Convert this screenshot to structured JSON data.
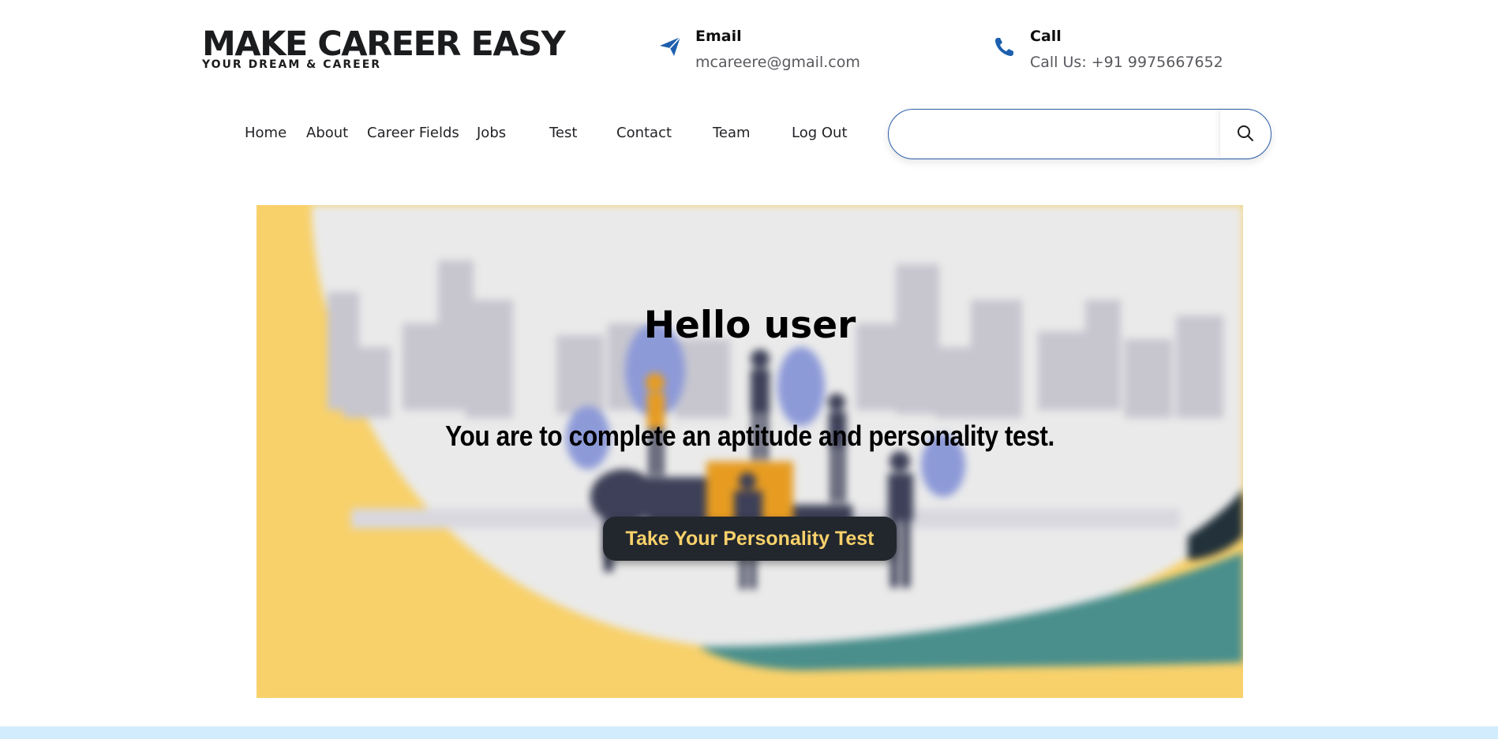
{
  "brand": {
    "title": "MAKE CAREER EASY",
    "tagline": "YOUR DREAM & CAREER"
  },
  "contacts": {
    "email": {
      "label": "Email",
      "value": "mcareere@gmail.com",
      "icon": "paper-plane-icon"
    },
    "call": {
      "label": "Call",
      "value": "Call Us: +91 9975667652",
      "icon": "phone-icon"
    }
  },
  "nav": {
    "items": [
      "Home",
      "About",
      "Career Fields",
      "Jobs",
      "Test",
      "Contact",
      "Team",
      "Log Out"
    ]
  },
  "search": {
    "placeholder": "",
    "icon": "search-icon"
  },
  "hero": {
    "title": "Hello user",
    "text": "You are to complete an aptitude and personality test.",
    "button_label": "Take Your Personality Test"
  },
  "colors": {
    "accent_blue": "#1d5fae",
    "hero_yellow": "#f8d16b",
    "button_dark": "#22272e",
    "footer_strip": "#d3ecfd"
  }
}
